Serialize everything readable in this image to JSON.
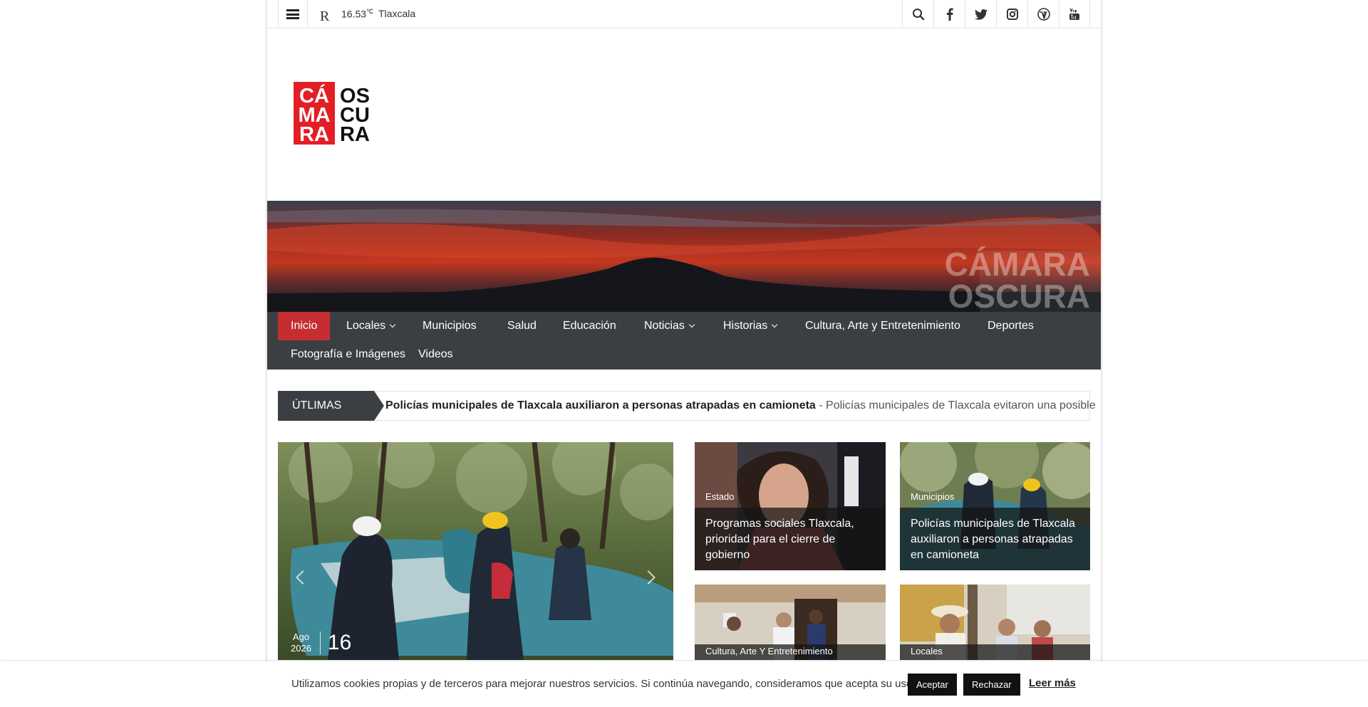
{
  "topbar": {
    "weather_glyph": "R",
    "temperature": "16.53",
    "temperature_unit": "℃",
    "city": "Tlaxcala",
    "social_icons": [
      "search-icon",
      "facebook-icon",
      "twitter-icon",
      "instagram-icon",
      "wordpress-icon",
      "youtube-icon"
    ]
  },
  "logo": {
    "lines_left": [
      "CÁ",
      "MA",
      "RA"
    ],
    "lines_right": [
      "OS",
      "CU",
      "RA"
    ],
    "brand_color": "#e31e24"
  },
  "banner": {
    "watermark_line1": "CÁMARA",
    "watermark_line2": "OSCURA"
  },
  "nav": {
    "items": [
      {
        "label": "Inicio",
        "active": true
      },
      {
        "label": "Locales",
        "dropdown": true
      },
      {
        "label": "Municipios"
      },
      {
        "label": "Salud"
      },
      {
        "label": "Educación"
      },
      {
        "label": "Noticias",
        "dropdown": true
      },
      {
        "label": "Historias",
        "dropdown": true
      },
      {
        "label": "Cultura, Arte y Entretenimiento"
      },
      {
        "label": "Deportes"
      },
      {
        "label": "Fotografía e Imágenes"
      },
      {
        "label": "Videos"
      }
    ],
    "active_color": "#c62d31",
    "bg_color": "#3b3f43"
  },
  "ticker": {
    "label": "ÚTLIMAS",
    "headline": "Policías municipales de Tlaxcala auxiliaron a personas atrapadas en camioneta",
    "summary": " - Policías municipales de Tlaxcala evitaron una posible"
  },
  "featured": {
    "month": "Ago",
    "year": "2026",
    "day": "16"
  },
  "cards": [
    {
      "category": "Estado",
      "title": "Programas sociales Tlaxcala, prioridad para el cierre de gobierno"
    },
    {
      "category": "Municipios",
      "title": "Policías municipales de Tlaxcala auxiliaron a personas atrapadas en camioneta"
    },
    {
      "category": "Cultura, Arte Y Entretenimiento"
    },
    {
      "category": "Locales"
    }
  ],
  "cookie": {
    "text": "Utilizamos cookies propias y de terceros para mejorar nuestros servicios. Si continúa navegando, consideramos que acepta su uso.",
    "accept_label": "Aceptar",
    "reject_label": "Rechazar",
    "read_more_label": "Leer más"
  }
}
